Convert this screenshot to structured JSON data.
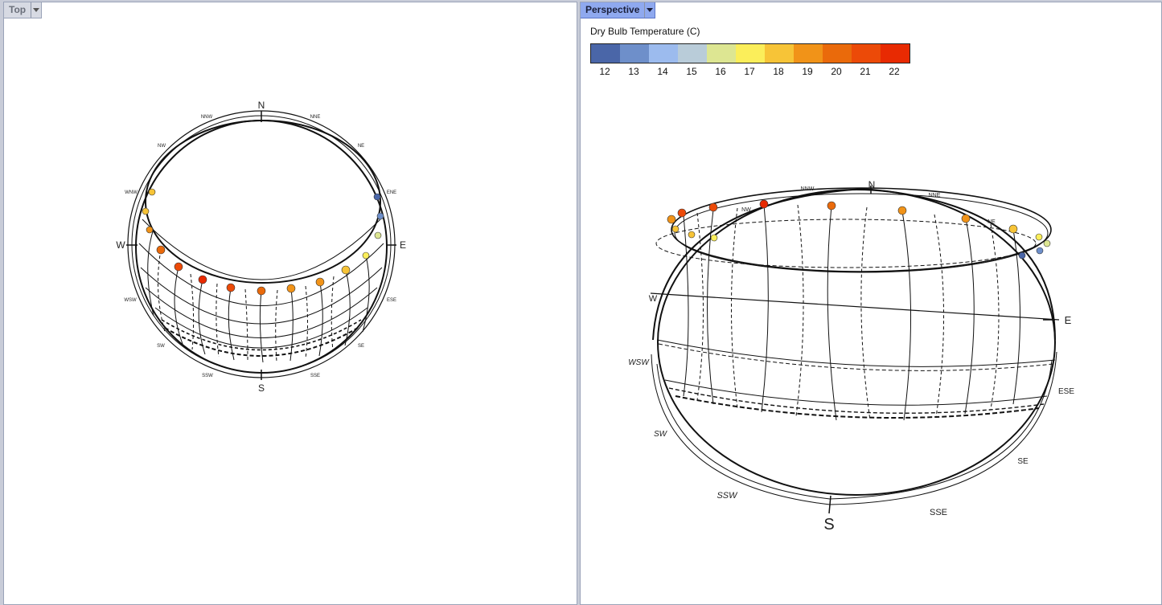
{
  "viewports": {
    "top": {
      "tab_label": "Top"
    },
    "perspective": {
      "tab_label": "Perspective"
    }
  },
  "legend": {
    "title": "Dry Bulb Temperature (C)",
    "colors": [
      "#4a66a8",
      "#6e8fca",
      "#9cbbee",
      "#b9ccd9",
      "#dde692",
      "#fbee5a",
      "#f7c437",
      "#f19318",
      "#ea6a0b",
      "#ec4a08",
      "#e82a02"
    ],
    "ticks": [
      "12",
      "13",
      "14",
      "15",
      "16",
      "17",
      "18",
      "19",
      "20",
      "21",
      "22"
    ]
  },
  "compass": {
    "cardinals": [
      "N",
      "E",
      "S",
      "W"
    ],
    "intercardinals": [
      "NNW",
      "NNE",
      "NE",
      "ENE",
      "ESE",
      "SE",
      "SSE",
      "SSW",
      "SW",
      "WSW",
      "WNW",
      "NW"
    ]
  },
  "top_view_labels": {
    "N": "N",
    "E": "E",
    "S": "S",
    "W": "W",
    "NNW": "NNW",
    "NNE": "NNE",
    "NW": "NW",
    "NE": "NE",
    "WNW": "WNW",
    "ENE": "ENE",
    "WSW": "WSW",
    "ESE": "ESE",
    "SW": "SW",
    "SE": "SE",
    "SSW": "SSW",
    "SSE": "SSE"
  },
  "persp_view_labels": {
    "N": "N",
    "E": "E",
    "S": "S",
    "W": "W",
    "NNW": "NNW",
    "NNE": "NNE",
    "NW": "NW",
    "NE": "NE",
    "WSW": "WSW",
    "ESE": "ESE",
    "SW": "SW",
    "SE": "SE",
    "SSW": "SSW",
    "SSE": "SSE"
  },
  "sun_points_top": [
    {
      "temp_color": "#f7c437"
    },
    {
      "temp_color": "#f7c437"
    },
    {
      "temp_color": "#f19318"
    },
    {
      "temp_color": "#ec4a08"
    },
    {
      "temp_color": "#e82a02"
    },
    {
      "temp_color": "#ec4a08"
    },
    {
      "temp_color": "#ea6a0b"
    },
    {
      "temp_color": "#f19318"
    },
    {
      "temp_color": "#f19318"
    },
    {
      "temp_color": "#f7c437"
    },
    {
      "temp_color": "#fbee5a"
    },
    {
      "temp_color": "#b9ccd9"
    },
    {
      "temp_color": "#4a66a8"
    },
    {
      "temp_color": "#6e8fca"
    }
  ]
}
